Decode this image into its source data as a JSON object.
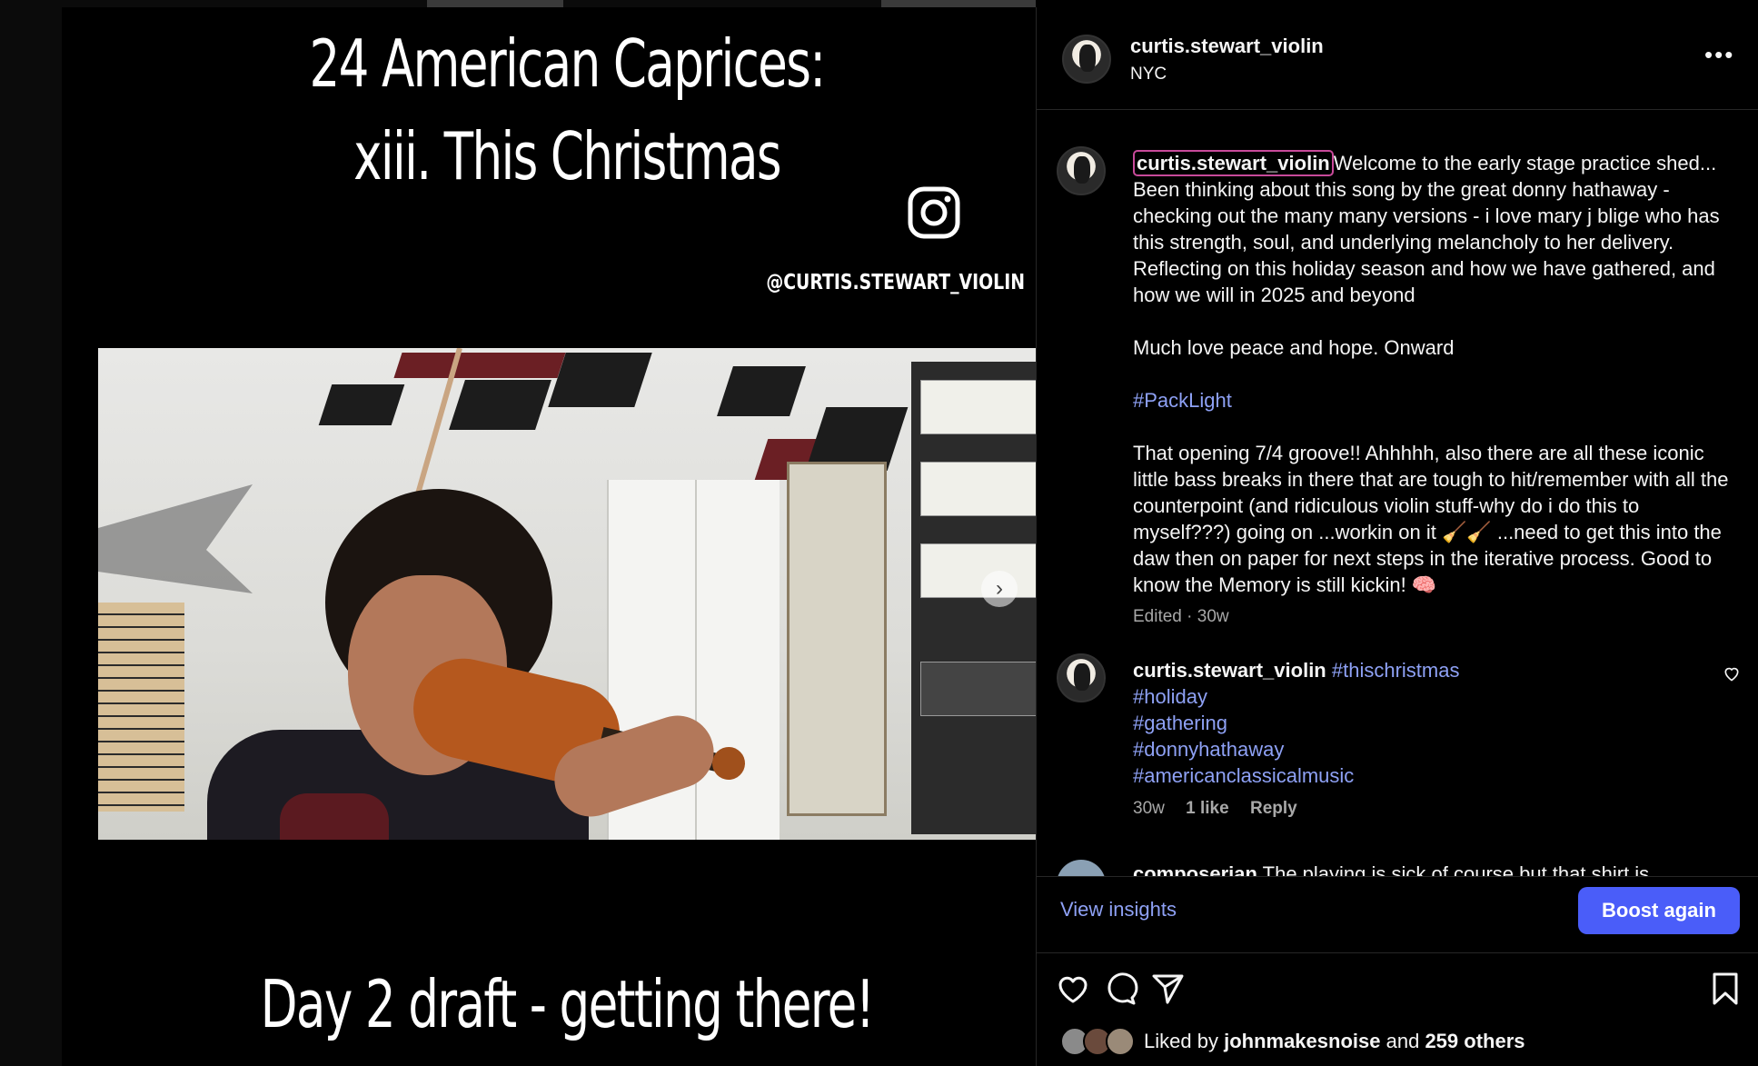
{
  "media": {
    "title_line1": "24 American Caprices:",
    "title_line2": "xiii. This Christmas",
    "watermark": "@CURTIS.STEWART_VIOLIN",
    "bottom_text": "Day 2 draft - getting there!"
  },
  "post": {
    "username": "curtis.stewart_violin",
    "location": "NYC",
    "caption_user": "curtis.stewart_violin",
    "caption_p1": "Welcome to the early stage practice shed... Been thinking about this song by the great donny hathaway - checking out the many many versions - i love mary j blige who has this strength, soul, and underlying melancholy to her delivery. Reflecting on this holiday season and how we have gathered, and how we will in 2025 and beyond",
    "caption_p2": "Much love peace and hope. Onward",
    "caption_tag": "#PackLight",
    "caption_p3": "That opening 7/4 groove!! Ahhhhh, also there are all these iconic little bass breaks in there that are tough to hit/remember with all the counterpoint (and ridiculous violin stuff-why do i do this to myself???) going on ...workin on it 🧹🧹 ...need to get this into the daw then on paper for next steps in the iterative process. Good to know the Memory is still kickin! 🧠",
    "caption_meta": "Edited · 30w"
  },
  "comment": {
    "username": "curtis.stewart_violin",
    "tags": [
      "#thischristmas",
      "#holiday",
      "#gathering",
      "#donnyhathaway",
      "#americanclassicalmusic"
    ],
    "time": "30w",
    "likes": "1 like",
    "reply": "Reply"
  },
  "partial_comment": {
    "username": "composerian",
    "text": "The playing is sick of course but that shirt is"
  },
  "actions": {
    "view_insights": "View insights",
    "boost": "Boost again"
  },
  "likes": {
    "prefix": "Liked by",
    "user": "johnmakesnoise",
    "and": "and",
    "others": "259 others"
  },
  "colors": {
    "accent_link": "#8ea1f5",
    "boost_button": "#4a5df9",
    "mention_outline": "#c84a9a"
  },
  "icons": [
    "more-horizontal-icon",
    "heart-icon",
    "comment-icon",
    "share-icon",
    "bookmark-icon",
    "chevron-right-icon",
    "instagram-icon"
  ]
}
